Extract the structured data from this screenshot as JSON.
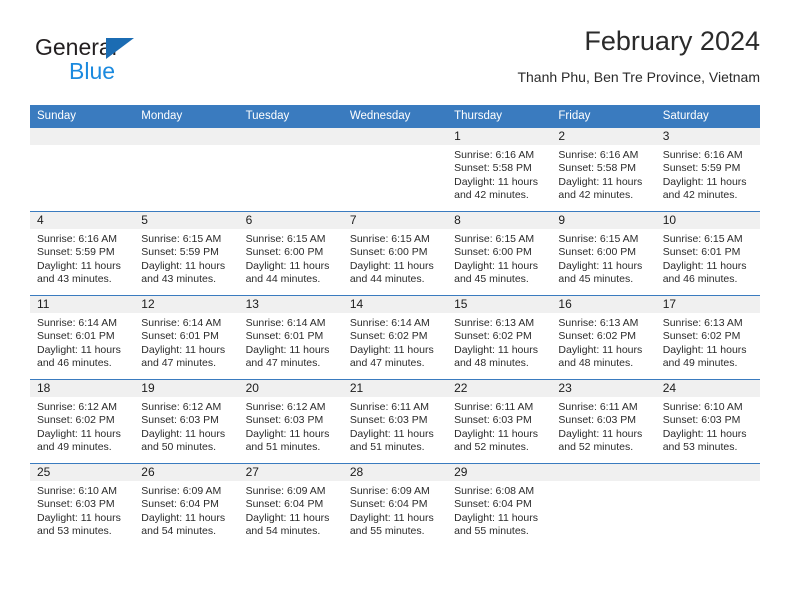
{
  "brand": {
    "name_top": "General",
    "name_bottom": "Blue",
    "triangle_color": "#1b6cb3",
    "blue_color": "#1b8adf"
  },
  "header": {
    "title": "February 2024",
    "subtitle": "Thanh Phu, Ben Tre Province, Vietnam"
  },
  "theme": {
    "header_row_bg": "#3a7bbf",
    "daynum_band_bg": "#f0f0f0",
    "row_border": "#3a7bbf"
  },
  "calendar": {
    "weekday_headers": [
      "Sunday",
      "Monday",
      "Tuesday",
      "Wednesday",
      "Thursday",
      "Friday",
      "Saturday"
    ],
    "weeks": [
      [
        {
          "day": "",
          "sunrise": "",
          "sunset": "",
          "daylight_line1": "",
          "daylight_line2": ""
        },
        {
          "day": "",
          "sunrise": "",
          "sunset": "",
          "daylight_line1": "",
          "daylight_line2": ""
        },
        {
          "day": "",
          "sunrise": "",
          "sunset": "",
          "daylight_line1": "",
          "daylight_line2": ""
        },
        {
          "day": "",
          "sunrise": "",
          "sunset": "",
          "daylight_line1": "",
          "daylight_line2": ""
        },
        {
          "day": "1",
          "sunrise": "Sunrise: 6:16 AM",
          "sunset": "Sunset: 5:58 PM",
          "daylight_line1": "Daylight: 11 hours",
          "daylight_line2": "and 42 minutes."
        },
        {
          "day": "2",
          "sunrise": "Sunrise: 6:16 AM",
          "sunset": "Sunset: 5:58 PM",
          "daylight_line1": "Daylight: 11 hours",
          "daylight_line2": "and 42 minutes."
        },
        {
          "day": "3",
          "sunrise": "Sunrise: 6:16 AM",
          "sunset": "Sunset: 5:59 PM",
          "daylight_line1": "Daylight: 11 hours",
          "daylight_line2": "and 42 minutes."
        }
      ],
      [
        {
          "day": "4",
          "sunrise": "Sunrise: 6:16 AM",
          "sunset": "Sunset: 5:59 PM",
          "daylight_line1": "Daylight: 11 hours",
          "daylight_line2": "and 43 minutes."
        },
        {
          "day": "5",
          "sunrise": "Sunrise: 6:15 AM",
          "sunset": "Sunset: 5:59 PM",
          "daylight_line1": "Daylight: 11 hours",
          "daylight_line2": "and 43 minutes."
        },
        {
          "day": "6",
          "sunrise": "Sunrise: 6:15 AM",
          "sunset": "Sunset: 6:00 PM",
          "daylight_line1": "Daylight: 11 hours",
          "daylight_line2": "and 44 minutes."
        },
        {
          "day": "7",
          "sunrise": "Sunrise: 6:15 AM",
          "sunset": "Sunset: 6:00 PM",
          "daylight_line1": "Daylight: 11 hours",
          "daylight_line2": "and 44 minutes."
        },
        {
          "day": "8",
          "sunrise": "Sunrise: 6:15 AM",
          "sunset": "Sunset: 6:00 PM",
          "daylight_line1": "Daylight: 11 hours",
          "daylight_line2": "and 45 minutes."
        },
        {
          "day": "9",
          "sunrise": "Sunrise: 6:15 AM",
          "sunset": "Sunset: 6:00 PM",
          "daylight_line1": "Daylight: 11 hours",
          "daylight_line2": "and 45 minutes."
        },
        {
          "day": "10",
          "sunrise": "Sunrise: 6:15 AM",
          "sunset": "Sunset: 6:01 PM",
          "daylight_line1": "Daylight: 11 hours",
          "daylight_line2": "and 46 minutes."
        }
      ],
      [
        {
          "day": "11",
          "sunrise": "Sunrise: 6:14 AM",
          "sunset": "Sunset: 6:01 PM",
          "daylight_line1": "Daylight: 11 hours",
          "daylight_line2": "and 46 minutes."
        },
        {
          "day": "12",
          "sunrise": "Sunrise: 6:14 AM",
          "sunset": "Sunset: 6:01 PM",
          "daylight_line1": "Daylight: 11 hours",
          "daylight_line2": "and 47 minutes."
        },
        {
          "day": "13",
          "sunrise": "Sunrise: 6:14 AM",
          "sunset": "Sunset: 6:01 PM",
          "daylight_line1": "Daylight: 11 hours",
          "daylight_line2": "and 47 minutes."
        },
        {
          "day": "14",
          "sunrise": "Sunrise: 6:14 AM",
          "sunset": "Sunset: 6:02 PM",
          "daylight_line1": "Daylight: 11 hours",
          "daylight_line2": "and 47 minutes."
        },
        {
          "day": "15",
          "sunrise": "Sunrise: 6:13 AM",
          "sunset": "Sunset: 6:02 PM",
          "daylight_line1": "Daylight: 11 hours",
          "daylight_line2": "and 48 minutes."
        },
        {
          "day": "16",
          "sunrise": "Sunrise: 6:13 AM",
          "sunset": "Sunset: 6:02 PM",
          "daylight_line1": "Daylight: 11 hours",
          "daylight_line2": "and 48 minutes."
        },
        {
          "day": "17",
          "sunrise": "Sunrise: 6:13 AM",
          "sunset": "Sunset: 6:02 PM",
          "daylight_line1": "Daylight: 11 hours",
          "daylight_line2": "and 49 minutes."
        }
      ],
      [
        {
          "day": "18",
          "sunrise": "Sunrise: 6:12 AM",
          "sunset": "Sunset: 6:02 PM",
          "daylight_line1": "Daylight: 11 hours",
          "daylight_line2": "and 49 minutes."
        },
        {
          "day": "19",
          "sunrise": "Sunrise: 6:12 AM",
          "sunset": "Sunset: 6:03 PM",
          "daylight_line1": "Daylight: 11 hours",
          "daylight_line2": "and 50 minutes."
        },
        {
          "day": "20",
          "sunrise": "Sunrise: 6:12 AM",
          "sunset": "Sunset: 6:03 PM",
          "daylight_line1": "Daylight: 11 hours",
          "daylight_line2": "and 51 minutes."
        },
        {
          "day": "21",
          "sunrise": "Sunrise: 6:11 AM",
          "sunset": "Sunset: 6:03 PM",
          "daylight_line1": "Daylight: 11 hours",
          "daylight_line2": "and 51 minutes."
        },
        {
          "day": "22",
          "sunrise": "Sunrise: 6:11 AM",
          "sunset": "Sunset: 6:03 PM",
          "daylight_line1": "Daylight: 11 hours",
          "daylight_line2": "and 52 minutes."
        },
        {
          "day": "23",
          "sunrise": "Sunrise: 6:11 AM",
          "sunset": "Sunset: 6:03 PM",
          "daylight_line1": "Daylight: 11 hours",
          "daylight_line2": "and 52 minutes."
        },
        {
          "day": "24",
          "sunrise": "Sunrise: 6:10 AM",
          "sunset": "Sunset: 6:03 PM",
          "daylight_line1": "Daylight: 11 hours",
          "daylight_line2": "and 53 minutes."
        }
      ],
      [
        {
          "day": "25",
          "sunrise": "Sunrise: 6:10 AM",
          "sunset": "Sunset: 6:03 PM",
          "daylight_line1": "Daylight: 11 hours",
          "daylight_line2": "and 53 minutes."
        },
        {
          "day": "26",
          "sunrise": "Sunrise: 6:09 AM",
          "sunset": "Sunset: 6:04 PM",
          "daylight_line1": "Daylight: 11 hours",
          "daylight_line2": "and 54 minutes."
        },
        {
          "day": "27",
          "sunrise": "Sunrise: 6:09 AM",
          "sunset": "Sunset: 6:04 PM",
          "daylight_line1": "Daylight: 11 hours",
          "daylight_line2": "and 54 minutes."
        },
        {
          "day": "28",
          "sunrise": "Sunrise: 6:09 AM",
          "sunset": "Sunset: 6:04 PM",
          "daylight_line1": "Daylight: 11 hours",
          "daylight_line2": "and 55 minutes."
        },
        {
          "day": "29",
          "sunrise": "Sunrise: 6:08 AM",
          "sunset": "Sunset: 6:04 PM",
          "daylight_line1": "Daylight: 11 hours",
          "daylight_line2": "and 55 minutes."
        },
        {
          "day": "",
          "sunrise": "",
          "sunset": "",
          "daylight_line1": "",
          "daylight_line2": ""
        },
        {
          "day": "",
          "sunrise": "",
          "sunset": "",
          "daylight_line1": "",
          "daylight_line2": ""
        }
      ]
    ]
  }
}
